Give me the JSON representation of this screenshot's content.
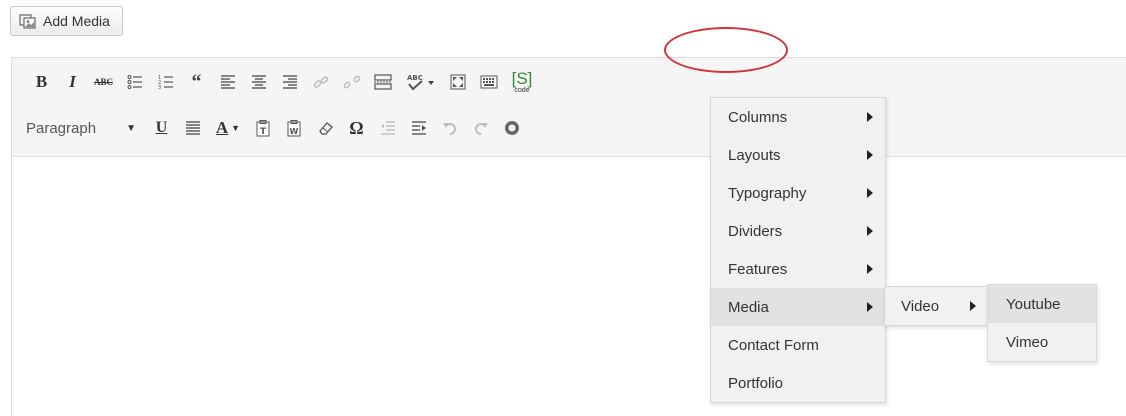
{
  "add_media": {
    "label": "Add Media",
    "icon": "media-icon"
  },
  "toolbar": {
    "row1": [
      {
        "name": "bold-button",
        "text": "B"
      },
      {
        "name": "italic-button",
        "text": "I"
      },
      {
        "name": "strikethrough-button",
        "text": "ABC"
      }
    ],
    "shortcode_label": "[S]",
    "shortcode_sub": "code",
    "format_select": "Paragraph",
    "omega": "Ω",
    "underline": "U",
    "text_color": "A"
  },
  "shortcode_menu": {
    "items": [
      {
        "label": "Columns",
        "submenu": true
      },
      {
        "label": "Layouts",
        "submenu": true
      },
      {
        "label": "Typography",
        "submenu": true
      },
      {
        "label": "Dividers",
        "submenu": true
      },
      {
        "label": "Features",
        "submenu": true
      },
      {
        "label": "Media",
        "submenu": true
      },
      {
        "label": "Contact Form",
        "submenu": false
      },
      {
        "label": "Portfolio",
        "submenu": false
      }
    ]
  },
  "media_submenu": {
    "items": [
      {
        "label": "Video",
        "submenu": true
      }
    ]
  },
  "video_submenu": {
    "items": [
      {
        "label": "Youtube"
      },
      {
        "label": "Vimeo"
      }
    ]
  },
  "colors": {
    "highlight_oval": "#d0343a",
    "shortcode_green": "#2e8b3a"
  }
}
